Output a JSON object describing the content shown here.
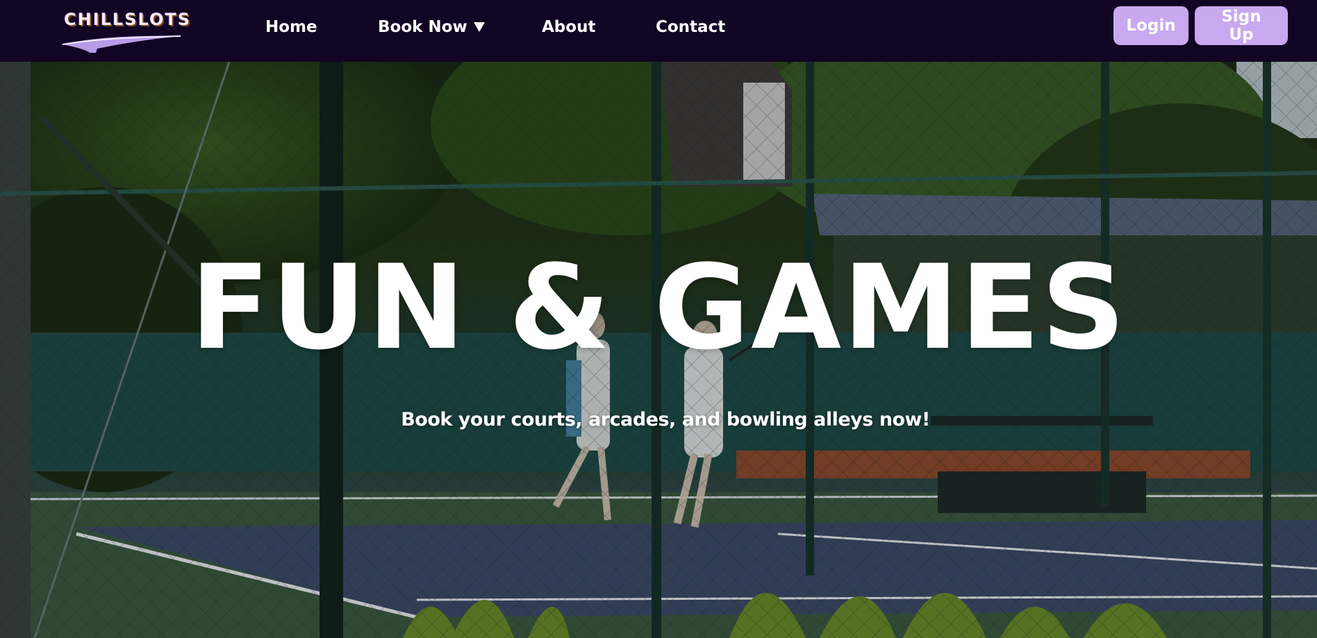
{
  "brand": {
    "name": "CHILLSLOTS"
  },
  "nav": {
    "home": "Home",
    "book_now": "Book Now",
    "about": "About",
    "contact": "Contact"
  },
  "auth": {
    "login": "Login",
    "signup": "Sign Up"
  },
  "hero": {
    "title": "FUN & GAMES",
    "subtitle": "Book your courts, arcades, and bowling alleys now!"
  },
  "icons": {
    "dropdown": "caret-down-icon"
  },
  "colors": {
    "navbar_bg": "#120524",
    "button_bg": "#c8a9f0",
    "text": "#ffffff"
  }
}
